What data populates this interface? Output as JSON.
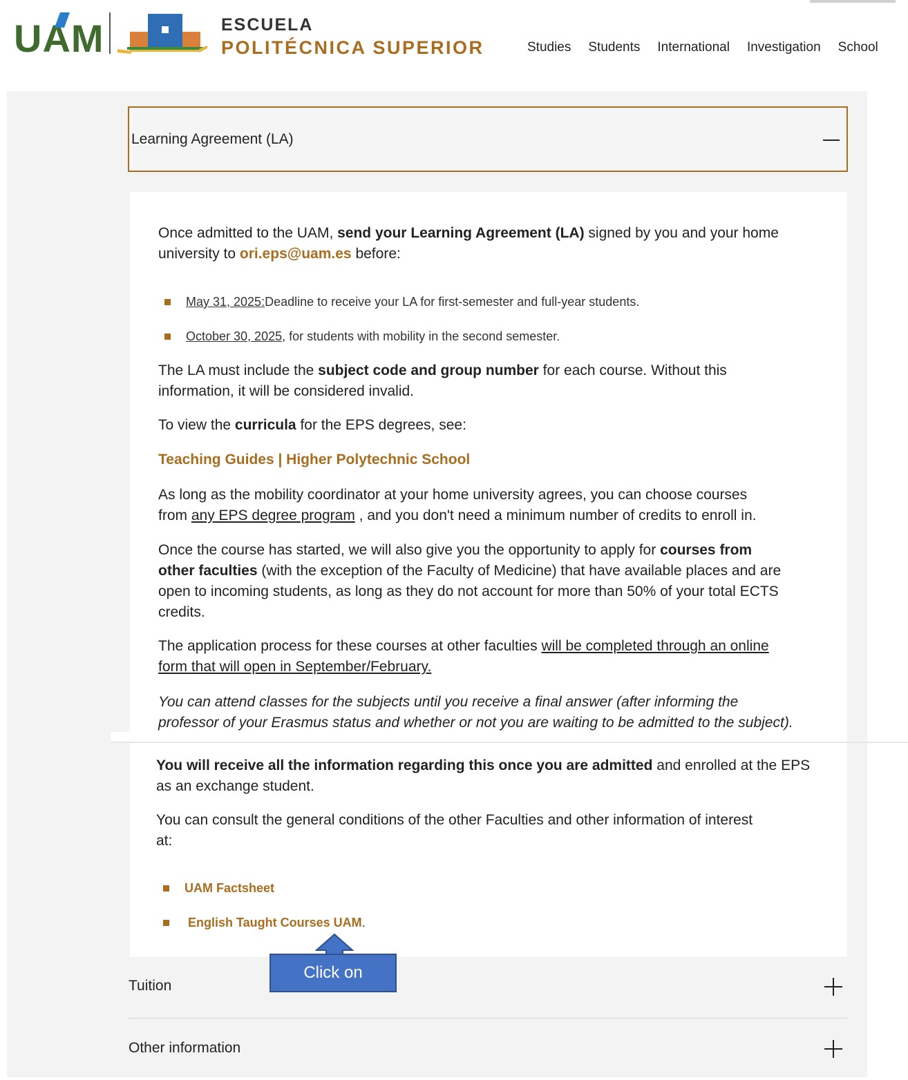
{
  "header": {
    "logo_text": "UAM",
    "school_line1": "ESCUELA",
    "school_line2": "POLITÉCNICA SUPERIOR",
    "nav": [
      "Studies",
      "Students",
      "International",
      "Investigation",
      "School"
    ]
  },
  "accordion": {
    "open_title": "Learning Agreement (LA)",
    "intro": {
      "a": "Once admitted to the UAM, ",
      "b": "send your Learning Agreement (LA)",
      "c": " signed by you and your home",
      "d": "university to ",
      "email": "ori.eps@uam.es",
      "e": " before:"
    },
    "deadlines": [
      {
        "date": "May 31, 2025:",
        "text": " Deadline to receive your LA for first-semester and full-year students."
      },
      {
        "date": "October 30, 2025",
        "text": " , for students with mobility in the second semester."
      }
    ],
    "la_include": {
      "a": "The LA must include the ",
      "b": "subject code and group number",
      "c": " for each course. Without this",
      "d": "information, it will be considered invalid."
    },
    "curricula": {
      "a": "To view the ",
      "b": "curricula",
      "c": " for the EPS degrees, see:"
    },
    "teaching_guides_link": "Teaching Guides | Higher Polytechnic School",
    "mobility": {
      "a": "As long as the mobility coordinator at your home university agrees, you can choose courses",
      "b": "from ",
      "link": "any EPS degree program",
      "c": " , and you don't need a minimum number of credits to enroll in."
    },
    "other_fac": {
      "a": "Once the course has started, we will also give you the opportunity to apply for ",
      "b": "courses from",
      "c": "other faculties",
      "d": " (with the exception of the Faculty of Medicine) that have available places and are",
      "e": "open to incoming students, as long as they do not account for more than 50% of your total ECTS",
      "f": "credits."
    },
    "application": {
      "a": "The application process for these courses at other faculties ",
      "b": "will be completed through an online",
      "c": "form that will open in September/February."
    },
    "attend": {
      "a": "You can attend classes for the subjects until you receive a final answer (after informing the",
      "b": "professor of your Erasmus status and whether or not you are waiting to be admitted to the subject)."
    },
    "receive": {
      "a": "You will receive all the information regarding this once you are admitted",
      "b": " and enrolled at the EPS",
      "c": "as an exchange student."
    },
    "consult": {
      "a": "You can consult the general conditions of the other Faculties and other information of interest",
      "b": "at:"
    },
    "links": [
      {
        "label": "UAM Factsheet",
        "suffix": ""
      },
      {
        "label": "English Taught Courses UAM",
        "suffix": " ."
      }
    ],
    "collapsed": [
      "Tuition",
      "Other information"
    ]
  },
  "callout": {
    "label": "Click on",
    "color": "#4472c4"
  },
  "colors": {
    "accent": "#a86d1e",
    "uam_green": "#3f6b2f"
  }
}
